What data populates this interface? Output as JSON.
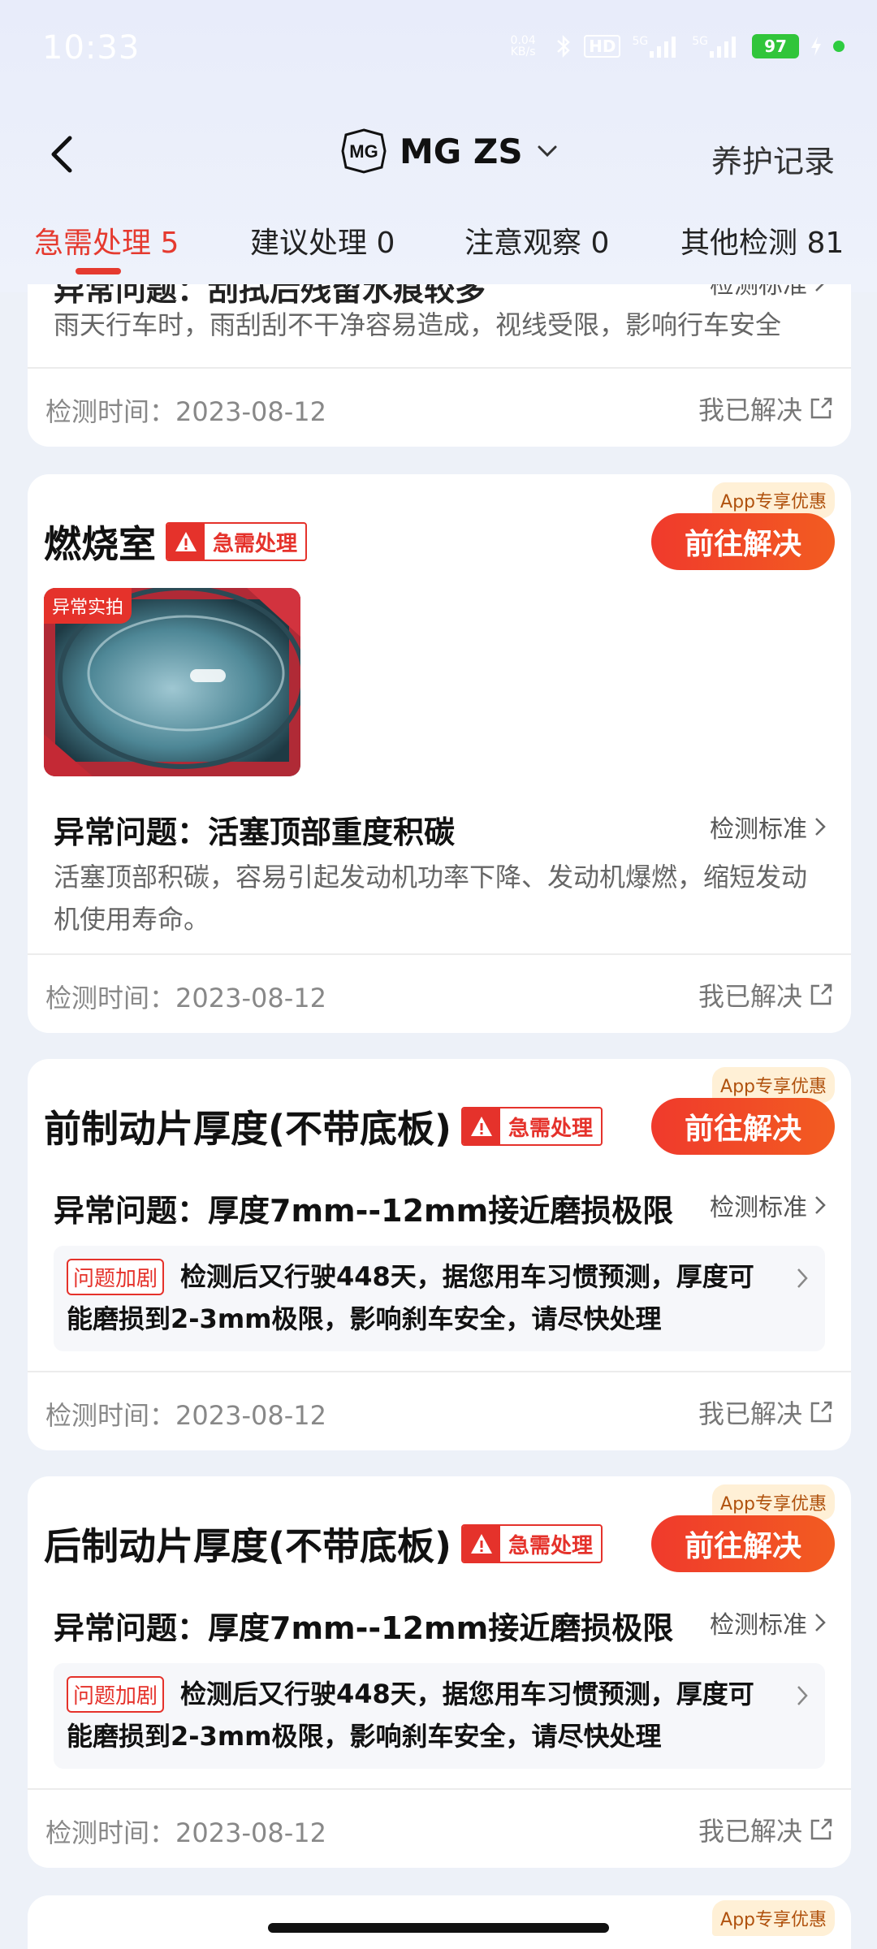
{
  "status_bar": {
    "time": "10:33",
    "net_speed": "0.04 KB/s",
    "hd_badge": "HD",
    "signal_1": "5G",
    "signal_2": "5G",
    "battery": "97"
  },
  "header": {
    "brand_name": "MG ZS",
    "maintenance_link": "养护记录"
  },
  "tabs": [
    {
      "label": "急需处理 5",
      "active": true
    },
    {
      "label": "建议处理 0",
      "active": false
    },
    {
      "label": "注意观察 0",
      "active": false
    },
    {
      "label": "其他检测 81",
      "active": false
    }
  ],
  "common": {
    "urgent_label": "急需处理",
    "promo_label": "App专享优惠",
    "go_label": "前往解决",
    "standard_label": "检测标准",
    "solved_label": "我已解决",
    "photo_tag": "异常实拍",
    "worse_badge": "问题加剧"
  },
  "cards": [
    {
      "title_partial": "异常问题：刮拭后残留水痕较多",
      "description": "雨天行车时，雨刮刮不干净容易造成，视线受限，影响行车安全",
      "detect_time": "检测时间：2023-08-12"
    },
    {
      "title": "燃烧室",
      "issue": "异常问题：活塞顶部重度积碳",
      "description": "活塞顶部积碳，容易引起发动机功率下降、发动机爆燃，缩短发动机使用寿命。",
      "detect_time": "检测时间：2023-08-12"
    },
    {
      "title": "前制动片厚度(不带底板)",
      "issue": "异常问题：厚度7mm--12mm接近磨损极限",
      "warning": "检测后又行驶448天，据您用车习惯预测，厚度可能磨损到2-3mm极限，影响刹车安全，请尽快处理",
      "detect_time": "检测时间：2023-08-12"
    },
    {
      "title": "后制动片厚度(不带底板)",
      "issue": "异常问题：厚度7mm--12mm接近磨损极限",
      "warning": "检测后又行驶448天，据您用车习惯预测，厚度可能磨损到2-3mm极限，影响刹车安全，请尽快处理",
      "detect_time": "检测时间：2023-08-12"
    }
  ],
  "colors": {
    "accent": "#e53a2f",
    "button_gradient_start": "#f03a2c",
    "button_gradient_end": "#f25c21",
    "page_bg": "#edf1f8"
  }
}
